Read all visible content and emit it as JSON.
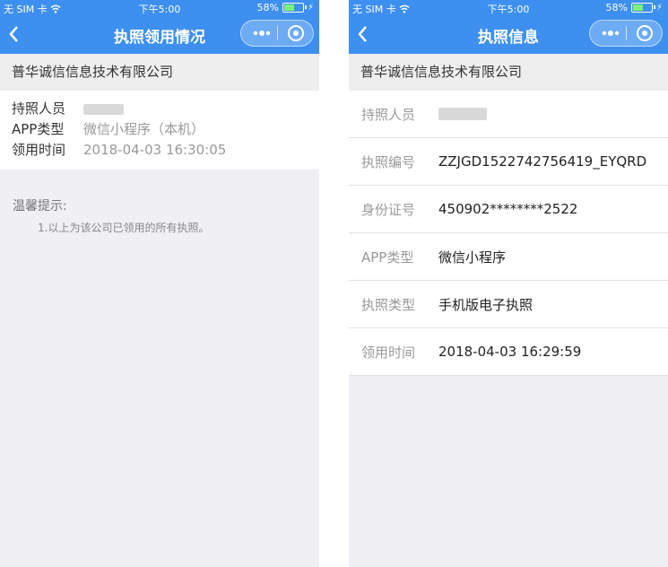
{
  "left": {
    "status": {
      "carrier": "无 SIM 卡",
      "time": "下午5:00",
      "battery": "58%"
    },
    "title": "执照领用情况",
    "company": "普华诚信信息技术有限公司",
    "rows": [
      {
        "label": "持照人员",
        "value": ""
      },
      {
        "label": "APP类型",
        "value": "微信小程序（本机）"
      },
      {
        "label": "领用时间",
        "value": "2018-04-03 16:30:05"
      }
    ],
    "tips": {
      "title": "温馨提示:",
      "line": "1.以上为该公司已领用的所有执照。"
    }
  },
  "right": {
    "status": {
      "carrier": "无 SIM 卡",
      "time": "下午5:00",
      "battery": "58%"
    },
    "title": "执照信息",
    "company": "普华诚信信息技术有限公司",
    "rows": [
      {
        "label": "持照人员",
        "value": ""
      },
      {
        "label": "执照编号",
        "value": "ZZJGD1522742756419_EYQRD"
      },
      {
        "label": "身份证号",
        "value": "450902********2522"
      },
      {
        "label": "APP类型",
        "value": "微信小程序"
      },
      {
        "label": "执照类型",
        "value": "手机版电子执照"
      },
      {
        "label": "领用时间",
        "value": "2018-04-03 16:29:59"
      }
    ]
  },
  "colors": {
    "primary": "#3d8ff0",
    "background": "#efeff4"
  },
  "icons": [
    "back-arrow-icon",
    "more-dots-icon",
    "close-target-icon",
    "wifi-icon",
    "battery-icon",
    "charging-bolt-icon"
  ]
}
